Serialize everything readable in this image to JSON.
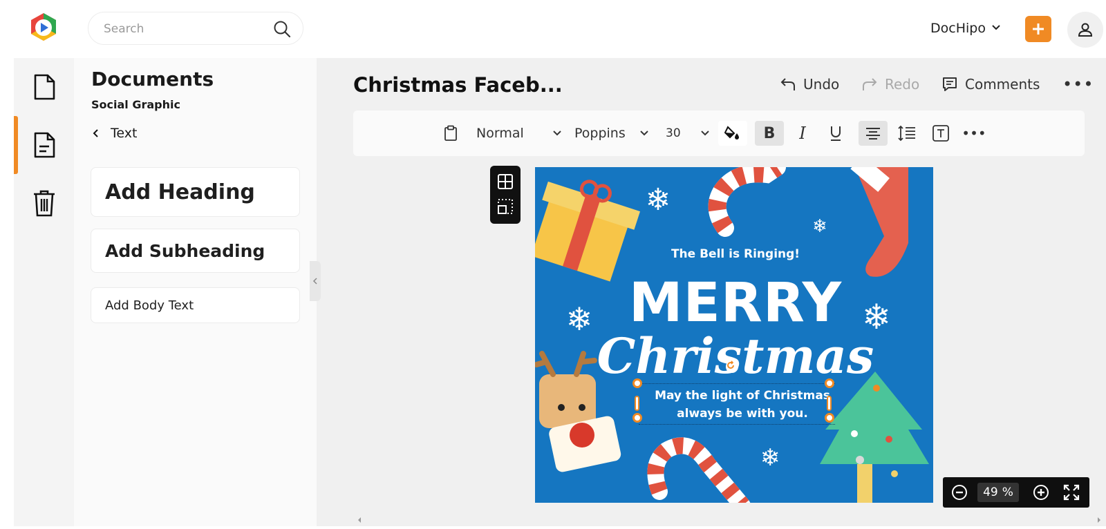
{
  "topbar": {
    "search_placeholder": "Search",
    "workspace_label": "DocHipo"
  },
  "panel": {
    "title": "Documents",
    "subtitle": "Social Graphic",
    "back_label": "Text",
    "cards": {
      "heading": "Add Heading",
      "subheading": "Add Subheading",
      "body": "Add Body Text"
    }
  },
  "editor": {
    "doc_title": "Christmas Faceb...",
    "undo_label": "Undo",
    "redo_label": "Redo",
    "comments_label": "Comments",
    "format": {
      "style": "Normal",
      "font": "Poppins",
      "size": "30"
    }
  },
  "design": {
    "tagline": "The Bell is Ringing!",
    "headline": "MERRY",
    "script": "Christmas",
    "wish_line1": "May the light of Christmas",
    "wish_line2": "always be with you."
  },
  "zoom": {
    "value": "49",
    "unit": "%"
  },
  "colors": {
    "accent": "#f08a24",
    "design_bg": "#1576c1"
  }
}
